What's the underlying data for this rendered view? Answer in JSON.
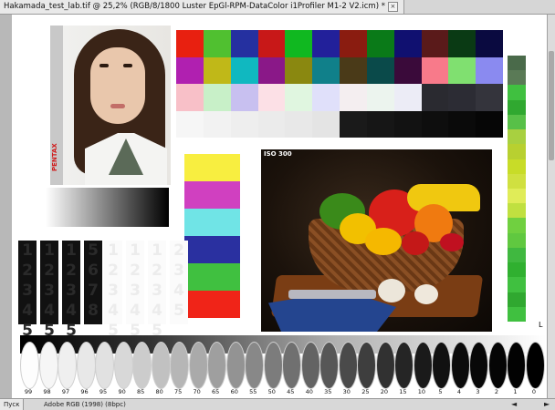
{
  "window": {
    "tab_title": "Hakamada_test_lab.tif @ 25,2% (RGB/8/1800 Luster EpGl-RPM-DataColor i1Profiler M1-2 V2.icm) *",
    "tab_close": "×"
  },
  "status_bar": {
    "start_label": "Пуск",
    "profile_info": "Adobe RGB (1998) (8bpc)",
    "left_arrow": "◄",
    "right_arrow": "►"
  },
  "portrait": {
    "brand_text": "PENTAX"
  },
  "photo": {
    "iso_label": "ISO 300"
  },
  "color_patches": [
    "#e82010",
    "#50c030",
    "#2530a0",
    "#c81818",
    "#10b820",
    "#22209a",
    "#8a1c10",
    "#0a7a18",
    "#101070",
    "#5a1a1a",
    "#0a3a14",
    "#0a0a40",
    "#b020b0",
    "#c0b818",
    "#10b8c0",
    "#8a1888",
    "#8a8810",
    "#10808a",
    "#4a3a18",
    "#0a4a4a",
    "#3a0a3a",
    "#f87a8a",
    "#80e070",
    "#8a8af0",
    "#f8c0c8",
    "#c8f0c8",
    "#c8c0f0",
    "#fce0e6",
    "#e0f6e0",
    "#e0e0fa",
    "#f4eef0",
    "#ecf4ee",
    "#ececf6",
    "#2a2a30",
    "#2c2c34",
    "#34343c",
    "#f6f6f6",
    "#f2f2f2",
    "#eeeeee",
    "#ebebeb",
    "#e8e8e8",
    "#e4e4e4",
    "#1a1a1a",
    "#161616",
    "#121212",
    "#0e0e0e",
    "#0a0a0a",
    "#060606"
  ],
  "vertical_colors": [
    "#f8ee40",
    "#d040c0",
    "#70e4e6",
    "#2a30a0",
    "#40c040",
    "#f02418"
  ],
  "green_steps": [
    "#4a6a4a",
    "#5a7a56",
    "#40c040",
    "#30a830",
    "#58c048",
    "#a8d040",
    "#b8d030",
    "#c8dc28",
    "#d0e040",
    "#e0ec58",
    "#c0e040",
    "#70d040",
    "#60c840",
    "#40b840",
    "#30b030",
    "#40c040",
    "#30a830",
    "#40c040"
  ],
  "dark_bar_digits": [
    "1 2 3 4 5",
    "1 2 3 4 5",
    "1 2 3 4 5",
    "5 6 7 8"
  ],
  "light_bar_digits": [
    "1 2 3 4 5",
    "1 2 3 4 5",
    "1 2 3 4 5",
    "2 3 4 5"
  ],
  "gray_ellipses": [
    {
      "label": "99",
      "shade": "#fdfdfd"
    },
    {
      "label": "98",
      "shade": "#f6f6f6"
    },
    {
      "label": "97",
      "shade": "#efefef"
    },
    {
      "label": "96",
      "shade": "#e8e8e8"
    },
    {
      "label": "95",
      "shade": "#e1e1e1"
    },
    {
      "label": "90",
      "shade": "#d8d8d8"
    },
    {
      "label": "85",
      "shade": "#cccccc"
    },
    {
      "label": "80",
      "shade": "#c1c1c1"
    },
    {
      "label": "75",
      "shade": "#b6b6b6"
    },
    {
      "label": "70",
      "shade": "#aaaaaa"
    },
    {
      "label": "65",
      "shade": "#9f9f9f"
    },
    {
      "label": "60",
      "shade": "#939393"
    },
    {
      "label": "55",
      "shade": "#888888"
    },
    {
      "label": "50",
      "shade": "#7c7c7c"
    },
    {
      "label": "45",
      "shade": "#707070"
    },
    {
      "label": "40",
      "shade": "#636363"
    },
    {
      "label": "35",
      "shade": "#575757"
    },
    {
      "label": "30",
      "shade": "#4a4a4a"
    },
    {
      "label": "25",
      "shade": "#3e3e3e"
    },
    {
      "label": "20",
      "shade": "#313131"
    },
    {
      "label": "15",
      "shade": "#252525"
    },
    {
      "label": "10",
      "shade": "#1a1a1a"
    },
    {
      "label": "5",
      "shade": "#111111"
    },
    {
      "label": "4",
      "shade": "#0c0c0c"
    },
    {
      "label": "3",
      "shade": "#080808"
    },
    {
      "label": "2",
      "shade": "#050505"
    },
    {
      "label": "1",
      "shade": "#020202"
    },
    {
      "label": "0",
      "shade": "#000000"
    }
  ],
  "corner_glyph": "L"
}
